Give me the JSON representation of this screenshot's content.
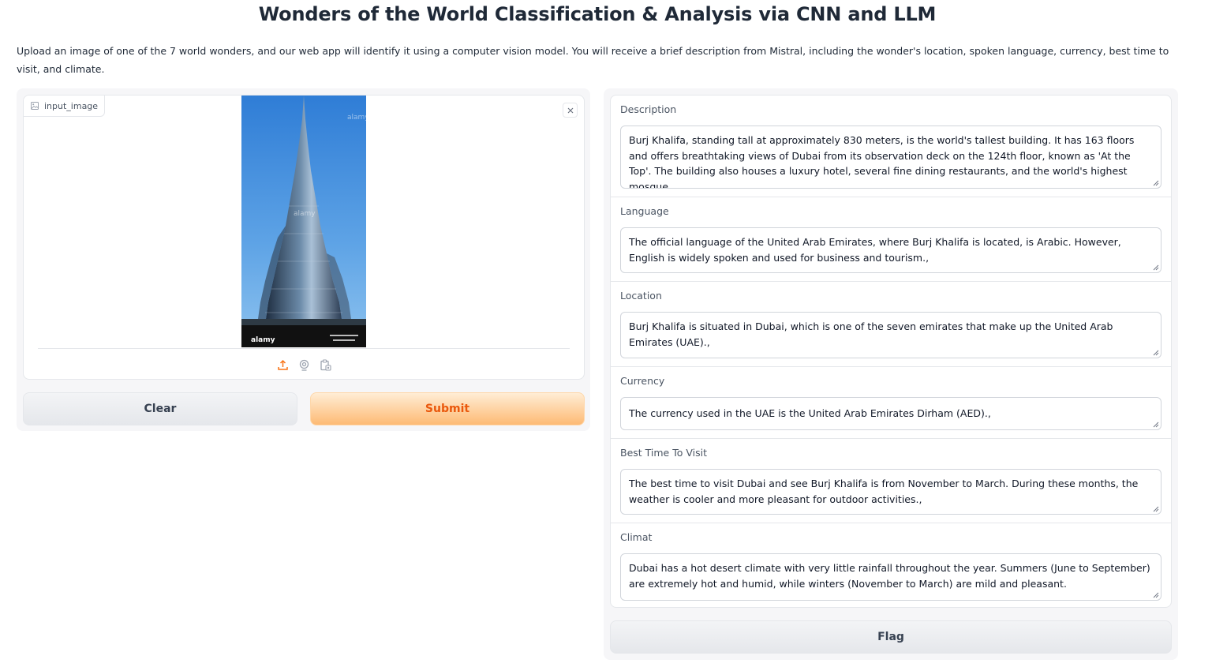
{
  "header": {
    "title": "Wonders of the World Classification & Analysis via CNN and LLM",
    "description": "Upload an image of one of the 7 world wonders, and our web app will identify it using a computer vision model. You will receive a brief description from Mistral, including the wonder's location, spoken language, currency, best time to visit, and climate."
  },
  "input": {
    "label": "input_image",
    "image_icon": "image-icon",
    "clear_icon": "close-icon",
    "sources": [
      "upload-icon",
      "webcam-icon",
      "clipboard-icon"
    ],
    "image_watermark": "alamy"
  },
  "buttons": {
    "clear": "Clear",
    "submit": "Submit",
    "flag": "Flag"
  },
  "outputs": [
    {
      "label": "Description",
      "value": " Burj Khalifa, standing tall at approximately 830 meters, is the world's tallest building. It has 163 floors and offers breathtaking views of Dubai from its observation deck on the 124th floor, known as 'At the Top'. The building also houses a luxury hotel, several fine dining restaurants, and the world's highest mosque.,"
    },
    {
      "label": "Language",
      "value": " The official language of the United Arab Emirates, where Burj Khalifa is located, is Arabic. However, English is widely spoken and used for business and tourism.,"
    },
    {
      "label": "Location",
      "value": " Burj Khalifa is situated in Dubai, which is one of the seven emirates that make up the United Arab Emirates (UAE).,"
    },
    {
      "label": "Currency",
      "value": " The currency used in the UAE is the United Arab Emirates Dirham (AED).,"
    },
    {
      "label": "Best Time To Visit",
      "value": " The best time to visit Dubai and see Burj Khalifa is from November to March. During these months, the weather is cooler and more pleasant for outdoor activities.,"
    },
    {
      "label": "Climat",
      "value": " Dubai has a hot desert climate with very little rainfall throughout the year. Summers (June to September) are extremely hot and humid, while winters (November to March) are mild and pleasant."
    }
  ],
  "colors": {
    "accent": "#ea580c",
    "submit_gradient_top": "#ffedd5",
    "submit_gradient_bottom": "#fdba74"
  }
}
